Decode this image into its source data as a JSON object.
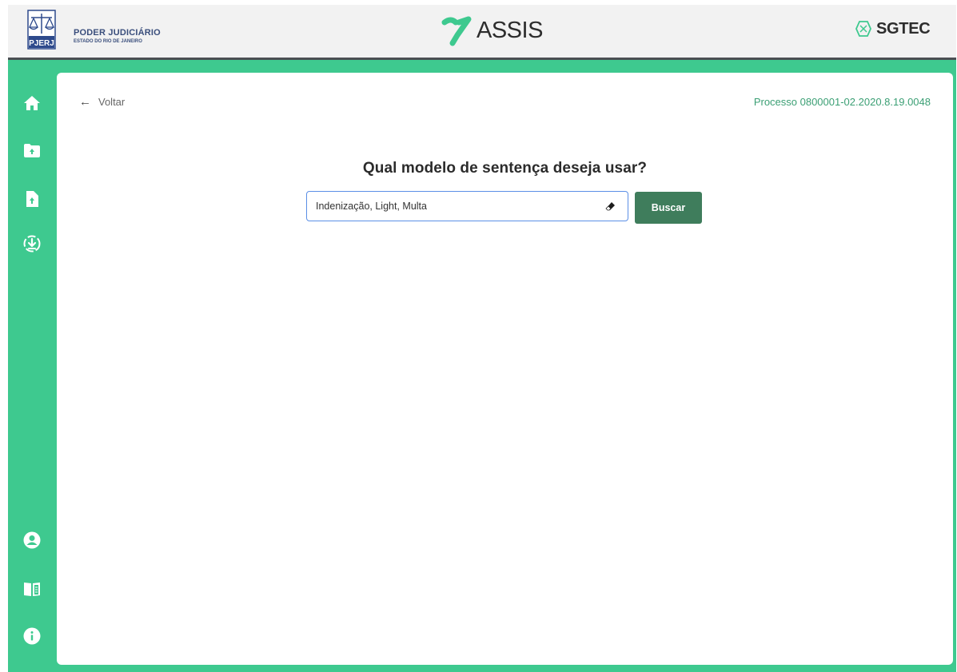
{
  "header": {
    "org_title": "PODER JUDICIÁRIO",
    "org_subtitle": "ESTADO DO RIO DE JANEIRO",
    "org_logo_text": "PJERJ",
    "app_name": "ASSIS",
    "partner_name": "SGTEC"
  },
  "sidebar": {
    "top_items": [
      {
        "icon": "home-icon"
      },
      {
        "icon": "folder-upload-icon"
      },
      {
        "icon": "file-upload-icon"
      },
      {
        "icon": "download-circle-icon"
      }
    ],
    "bottom_items": [
      {
        "icon": "user-icon"
      },
      {
        "icon": "book-icon"
      },
      {
        "icon": "info-icon"
      }
    ]
  },
  "main": {
    "back_label": "Voltar",
    "process_label": "Processo 0800001-02.2020.8.19.0048",
    "question": "Qual modelo de sentença deseja usar?",
    "search": {
      "value": "Indenização, Light, Multa",
      "button_label": "Buscar"
    }
  },
  "colors": {
    "accent_green": "#3ec98f",
    "button_green": "#3f7d5c",
    "process_text": "#3b9f74",
    "focus_border": "#5b8fe6"
  }
}
